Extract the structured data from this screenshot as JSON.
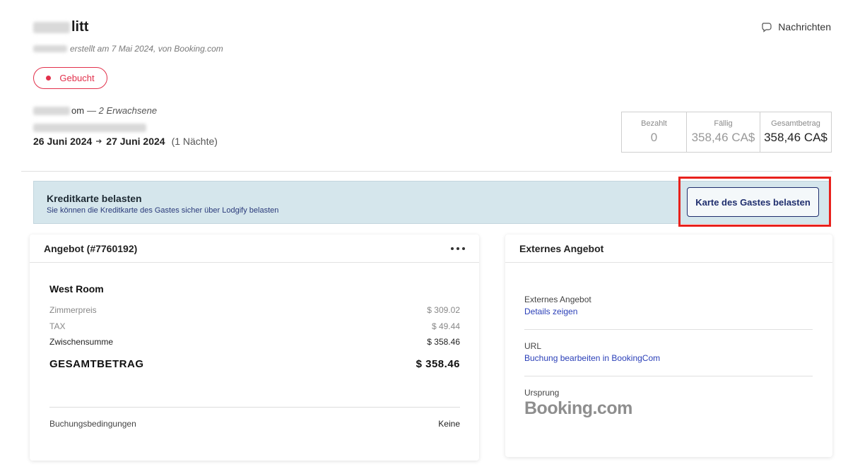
{
  "header": {
    "guest_name_suffix": "litt",
    "created_text": "erstellt am 7 Mai 2024, von Booking.com",
    "messages_label": "Nachrichten"
  },
  "status": {
    "label": "Gebucht",
    "color": "#e2304b"
  },
  "reservation": {
    "rental_suffix": "om",
    "guests": "— 2 Erwachsene",
    "date_from": "26 Juni 2024",
    "date_to": "27 Juni 2024",
    "nights": "(1 Nächte)"
  },
  "totals": {
    "paid_label": "Bezahlt",
    "paid_value": "0",
    "due_label": "Fällig",
    "due_value": "358,46 CA$",
    "total_label": "Gesamtbetrag",
    "total_value": "358,46 CA$"
  },
  "charge_banner": {
    "title": "Kreditkarte belasten",
    "subtitle": "Sie können die Kreditkarte des Gastes sicher über Lodgify belasten",
    "button": "Karte des Gastes belasten"
  },
  "offer": {
    "title": "Angebot (#7760192)",
    "room": "West Room",
    "rows": [
      {
        "label": "Zimmerpreis",
        "value": "$ 309.02"
      },
      {
        "label": "TAX",
        "value": "$ 49.44"
      },
      {
        "label": "Zwischensumme",
        "value": "$ 358.46"
      },
      {
        "label": "GESAMTBETRAG",
        "value": "$ 358.46"
      }
    ],
    "conditions_label": "Buchungsbedingungen",
    "conditions_value": "Keine"
  },
  "external": {
    "title": "Externes Angebot",
    "items": [
      {
        "label": "Externes Angebot",
        "value": "Details zeigen"
      },
      {
        "label": "URL",
        "value": "Buchung bearbeiten in BookingCom"
      },
      {
        "label": "Ursprung",
        "value": "Booking.com"
      }
    ]
  },
  "colors": {
    "accent_red": "#e2304b",
    "banner_bg": "#d5e6ec",
    "link_blue": "#2a3fb8",
    "button_navy": "#1f2e6d"
  }
}
